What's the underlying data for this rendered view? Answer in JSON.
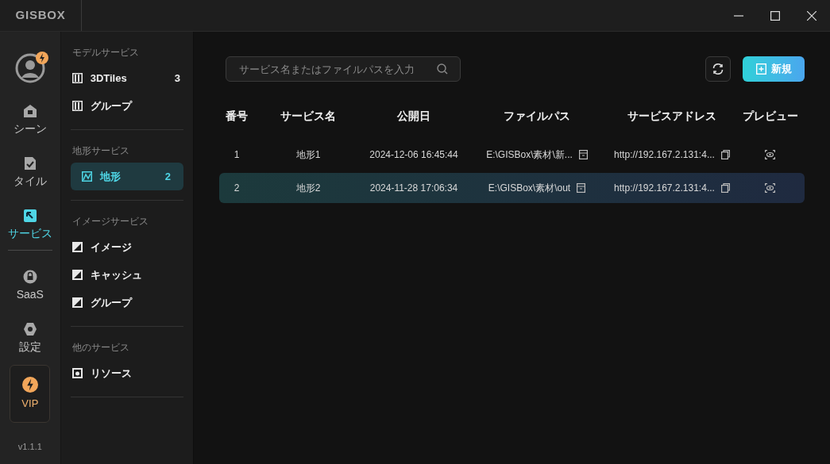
{
  "logo": "GISBOX",
  "rail": [
    {
      "label": "シーン",
      "selected": false
    },
    {
      "label": "タイル",
      "selected": false
    },
    {
      "label": "サービス",
      "selected": true
    },
    {
      "label": "SaaS",
      "selected": false
    },
    {
      "label": "設定",
      "selected": false
    }
  ],
  "vip": "VIP",
  "version": "v1.1.1",
  "sidebar": [
    {
      "title": "モデルサービス",
      "items": [
        {
          "label": "3DTiles",
          "count": "3",
          "selected": false
        },
        {
          "label": "グループ",
          "selected": false
        }
      ]
    },
    {
      "title": "地形サービス",
      "items": [
        {
          "label": "地形",
          "count": "2",
          "selected": true
        }
      ]
    },
    {
      "title": "イメージサービス",
      "items": [
        {
          "label": "イメージ",
          "selected": false
        },
        {
          "label": "キャッシュ",
          "selected": false
        },
        {
          "label": "グループ",
          "selected": false
        }
      ]
    },
    {
      "title": "他のサービス",
      "items": [
        {
          "label": "リソース",
          "selected": false
        }
      ]
    }
  ],
  "search": {
    "placeholder": "サービス名またはファイルパスを入力"
  },
  "new_button": "新規",
  "table": {
    "columns": [
      "番号",
      "サービス名",
      "公開日",
      "ファイルパス",
      "サービスアドレス",
      "プレビュー"
    ],
    "rows": [
      {
        "no": "1",
        "name": "地形1",
        "date": "2024-12-06 16:45:44",
        "path": "E:\\GISBox\\素材\\新...",
        "address": "http://192.167.2.131:4...",
        "selected": false
      },
      {
        "no": "2",
        "name": "地形2",
        "date": "2024-11-28 17:06:34",
        "path": "E:\\GISBox\\素材\\out",
        "address": "http://192.167.2.131:4...",
        "selected": true
      }
    ]
  }
}
